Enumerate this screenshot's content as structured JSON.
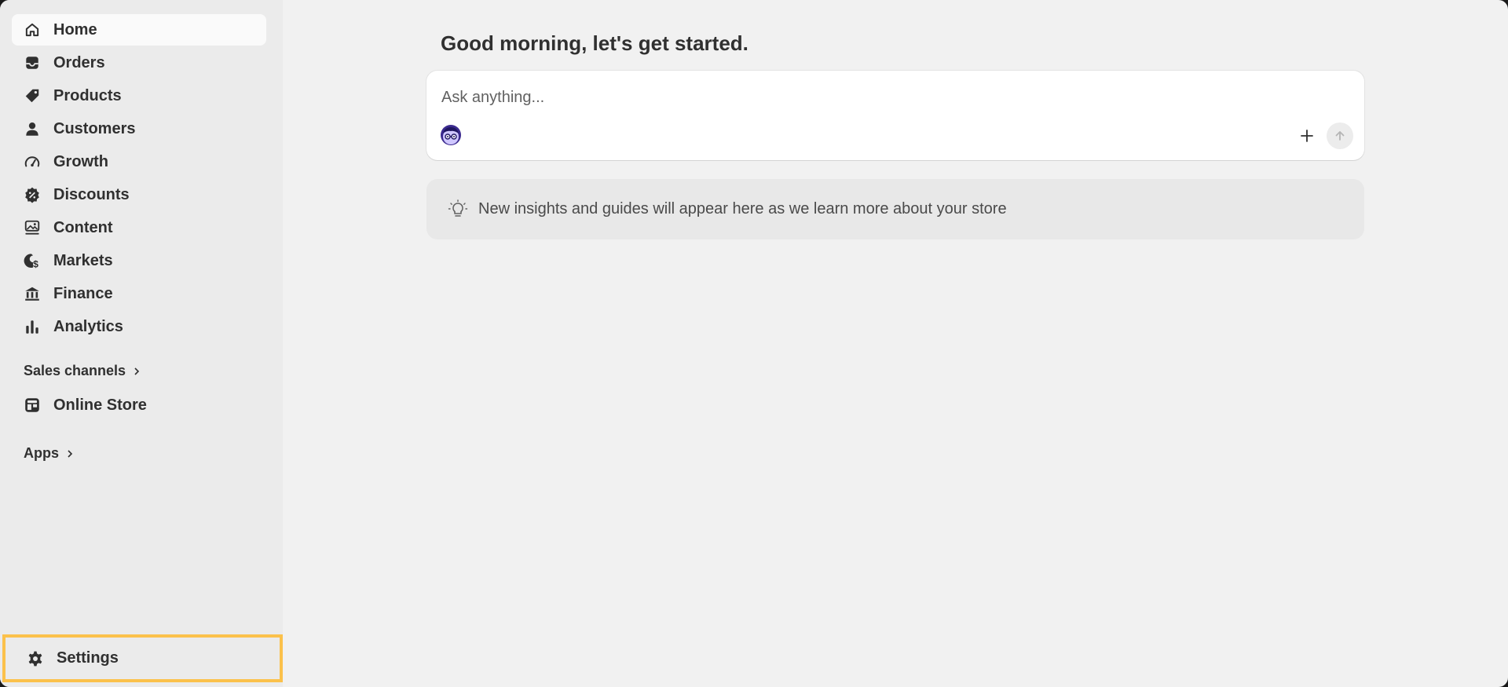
{
  "sidebar": {
    "items": [
      {
        "label": "Home",
        "icon": "home-icon",
        "active": true
      },
      {
        "label": "Orders",
        "icon": "inbox-icon"
      },
      {
        "label": "Products",
        "icon": "tag-icon"
      },
      {
        "label": "Customers",
        "icon": "person-icon"
      },
      {
        "label": "Growth",
        "icon": "gauge-icon"
      },
      {
        "label": "Discounts",
        "icon": "discount-icon"
      },
      {
        "label": "Content",
        "icon": "image-icon"
      },
      {
        "label": "Markets",
        "icon": "globe-icon"
      },
      {
        "label": "Finance",
        "icon": "bank-icon"
      },
      {
        "label": "Analytics",
        "icon": "bar-chart-icon"
      }
    ],
    "sales_channels": {
      "label": "Sales channels",
      "items": [
        {
          "label": "Online Store",
          "icon": "store-icon"
        }
      ]
    },
    "apps": {
      "label": "Apps"
    },
    "settings": {
      "label": "Settings",
      "icon": "gear-icon"
    }
  },
  "main": {
    "greeting": "Good morning, let's get started.",
    "ask": {
      "placeholder": "Ask anything..."
    },
    "insights": "New insights and guides will appear here as we learn more about your store"
  },
  "colors": {
    "sidebar_bg": "#ebebeb",
    "main_bg": "#f1f1f1",
    "highlight": "#fbc14b",
    "text": "#303030"
  }
}
